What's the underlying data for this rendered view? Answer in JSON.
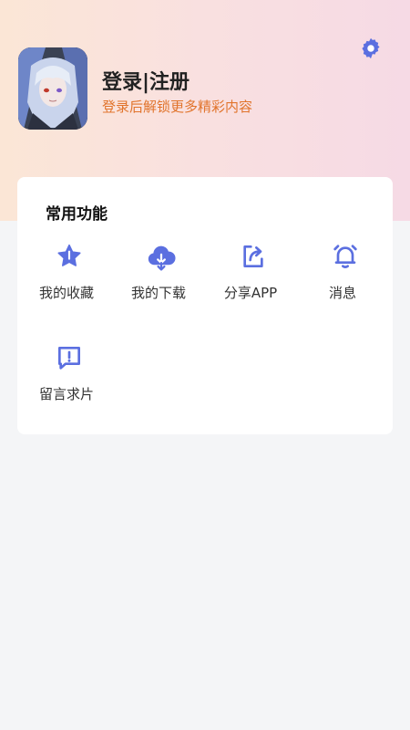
{
  "profile": {
    "title": "登录|注册",
    "subtitle": "登录后解锁更多精彩内容"
  },
  "section": {
    "title": "常用功能"
  },
  "functions": [
    {
      "label": "我的收藏",
      "icon": "star-icon"
    },
    {
      "label": "我的下载",
      "icon": "cloud-download-icon"
    },
    {
      "label": "分享APP",
      "icon": "share-icon"
    },
    {
      "label": "消息",
      "icon": "bell-icon"
    },
    {
      "label": "留言求片",
      "icon": "message-alert-icon"
    }
  ],
  "colors": {
    "accent": "#5b6fe0",
    "subtitle": "#e1742c",
    "header_gradient_start": "#fbe6d6",
    "header_gradient_end": "#f6dae5"
  }
}
